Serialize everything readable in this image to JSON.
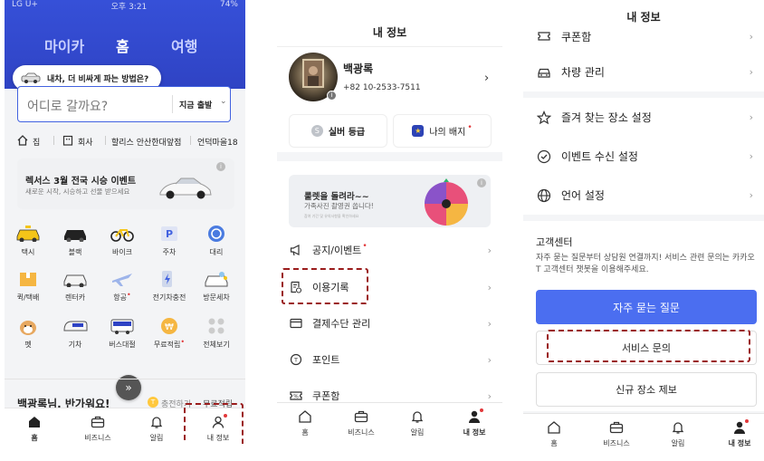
{
  "panel1": {
    "status": {
      "carrier": "LG U+",
      "time": "오후 3:21",
      "battery": "74%"
    },
    "tabs": [
      "마이카",
      "홈",
      "여행"
    ],
    "promo_tooltip": "내차, 더 비싸게 파는 방법은?",
    "search": {
      "placeholder": "어디로 갈까요?",
      "time_label": "지금 출발"
    },
    "quick_places": [
      "집",
      "회사",
      "할리스 안산한대앞점",
      "언덕마을18"
    ],
    "banner": {
      "title": "렉서스 3월 전국 시승 이벤트",
      "subtitle": "새로운 시작, 시승하고 선물 받으세요"
    },
    "services": [
      {
        "label": "택시",
        "icon": "taxi-icon"
      },
      {
        "label": "블랙",
        "icon": "black-car-icon"
      },
      {
        "label": "바이크",
        "icon": "bike-icon"
      },
      {
        "label": "주차",
        "icon": "parking-icon"
      },
      {
        "label": "대리",
        "icon": "driver-icon"
      },
      {
        "label": "퀵/택배",
        "icon": "box-icon"
      },
      {
        "label": "렌터카",
        "icon": "rental-car-icon"
      },
      {
        "label": "항공",
        "icon": "plane-icon"
      },
      {
        "label": "전기차충전",
        "icon": "ev-charge-icon"
      },
      {
        "label": "방문세차",
        "icon": "car-wash-icon"
      },
      {
        "label": "펫",
        "icon": "pet-icon"
      },
      {
        "label": "기차",
        "icon": "train-icon"
      },
      {
        "label": "버스대절",
        "icon": "bus-icon"
      },
      {
        "label": "무료적립",
        "icon": "coin-icon"
      },
      {
        "label": "전체보기",
        "icon": "grid-icon"
      }
    ],
    "greeting": "백광록님, 반가워요!",
    "charge_label": "충전하기",
    "free_points": "무료적립",
    "nav": [
      "홈",
      "비즈니스",
      "알림",
      "내 정보"
    ]
  },
  "panel2": {
    "title": "내 정보",
    "profile": {
      "name": "백광록",
      "phone": "+82 10-2533-7511"
    },
    "grade": "실버 등급",
    "badge": "나의 배지",
    "roulette": {
      "title": "룰렛을 돌려라~~",
      "subtitle": "가족사진 촬영권 쏩니다!",
      "fine": "참여 기간 및 유의사항을 확인하세요"
    },
    "menu": [
      "공지/이벤트",
      "이용기록",
      "결제수단 관리",
      "포인트",
      "쿠폰함"
    ],
    "nav": [
      "홈",
      "비즈니스",
      "알림",
      "내 정보"
    ]
  },
  "panel3": {
    "title": "내 정보",
    "partial_row": "쿠폰함",
    "vehicle": "차량 관리",
    "settings": [
      "즐겨 찾는 장소 설정",
      "이벤트 수신 설정",
      "언어 설정"
    ],
    "cs": {
      "title": "고객센터",
      "desc": "자주 묻는 질문부터 상담원 연결까지! 서비스 관련 문의는 카카오 T 고객센터 챗봇을 이용해주세요.",
      "faq": "자주 묻는 질문",
      "inquiry": "서비스 문의",
      "report": "신규 장소 제보"
    },
    "nav": [
      "홈",
      "비즈니스",
      "알림",
      "내 정보"
    ]
  },
  "colors": {
    "brand": "#3650d8",
    "button": "#4b6ef0",
    "highlight": "#9a1c1c",
    "dot": "#e2383a"
  }
}
